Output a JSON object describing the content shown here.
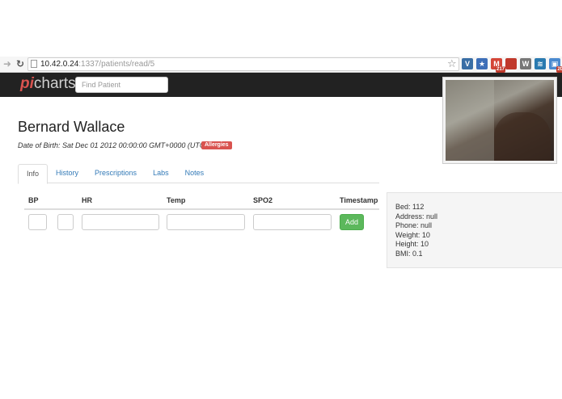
{
  "browser": {
    "url_host": "10.42.0.24",
    "url_path": ":1337/patients/read/5",
    "extensions": [
      {
        "icon": "vimium-icon",
        "glyph": "V",
        "color": "#3a6ea5",
        "badge": ""
      },
      {
        "icon": "bookmark-star-icon",
        "glyph": "★",
        "color": "#3d6fb8",
        "badge": ""
      },
      {
        "icon": "gmail-icon",
        "glyph": "M",
        "color": "#d44638",
        "badge": "217"
      },
      {
        "icon": "red-book-icon",
        "glyph": "",
        "color": "#c0392b",
        "badge": ""
      },
      {
        "icon": "wordpress-icon",
        "glyph": "W",
        "color": "#777777",
        "badge": ""
      },
      {
        "icon": "wave-icon",
        "glyph": "≋",
        "color": "#2a7ab0",
        "badge": ""
      },
      {
        "icon": "monitor-icon",
        "glyph": "▣",
        "color": "#4a8ad0",
        "badge": "20"
      }
    ]
  },
  "app": {
    "brand_pi": "pi",
    "brand_rest": "charts",
    "search_placeholder": "Find Patient"
  },
  "patient": {
    "name": "Bernard Wallace",
    "dob": "Date of Birth: Sat Dec 01 2012 00:00:00 GMT+0000 (UTC)",
    "allergies_label": "Allergies"
  },
  "tabs": [
    {
      "label": "Info",
      "active": true
    },
    {
      "label": "History",
      "active": false
    },
    {
      "label": "Prescriptions",
      "active": false
    },
    {
      "label": "Labs",
      "active": false
    },
    {
      "label": "Notes",
      "active": false
    }
  ],
  "vitals": {
    "headers": {
      "bp": "BP",
      "hr": "HR",
      "temp": "Temp",
      "spo2": "SPO2",
      "timestamp": "Timestamp"
    },
    "add_label": "Add"
  },
  "info": {
    "bed": "Bed: 112",
    "address": "Address: null",
    "phone": "Phone: null",
    "weight": "Weight: 10",
    "height": "Height: 10",
    "bmi": "BMI: 0.1"
  },
  "colors": {
    "navbar_bg": "#222222",
    "brand_accent": "#d9534f",
    "link": "#337ab7",
    "add_button": "#5cb85c",
    "allergies_badge": "#d9534f"
  }
}
